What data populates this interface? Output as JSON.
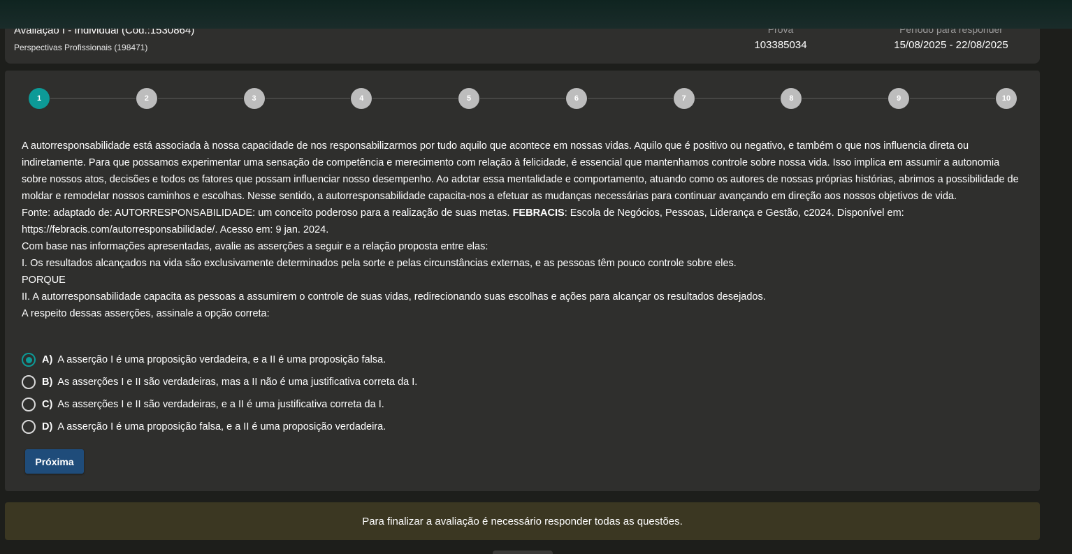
{
  "header": {
    "title": "Avaliação I - Individual (Cod.:1530864)",
    "course": "Perspectivas Profissionais (198471)",
    "prova_label": "Prova",
    "prova_value": "103385034",
    "periodo_label": "Período para responder",
    "periodo_value": "15/08/2025 - 22/08/2025"
  },
  "stepper": {
    "steps": [
      "1",
      "2",
      "3",
      "4",
      "5",
      "6",
      "7",
      "8",
      "9",
      "10"
    ],
    "active_step": 1,
    "colors": {
      "active": "#0d9a97",
      "inactive": "#bdbdbd"
    }
  },
  "question": {
    "text": "A autorresponsabilidade está associada à nossa capacidade de nos responsabilizarmos por tudo aquilo que acontece em nossas vidas. Aquilo que é positivo ou negativo, e também o que nos influencia direta ou indiretamente. Para que possamos experimentar uma sensação de competência e merecimento com relação à felicidade, é essencial que mantenhamos controle sobre nossa vida. Isso implica em assumir a autonomia sobre nossos atos, decisões e todos os fatores que possam influenciar nosso desempenho. Ao adotar essa mentalidade e comportamento, atuando como os autores de nossas próprias histórias, abrimos a possibilidade de moldar e remodelar nossos caminhos e escolhas. Nesse sentido, a autorresponsabilidade capacita-nos a efetuar as mudanças necessárias para continuar avançando em direção aos nossos objetivos de vida.",
    "source_prefix": "Fonte: adaptado de: AUTORRESPONSABILIDADE: um conceito poderoso para a realização de suas metas. ",
    "source_bold": "FEBRACIS",
    "source_suffix": ": Escola de Negócios, Pessoas, Liderança e Gestão, c2024. Disponível em: https://febracis.com/autorresponsabilidade/. Acesso em: 9 jan. 2024.",
    "instruction": "Com base nas informações apresentadas, avalie as asserções a seguir e a relação proposta entre elas:",
    "assertion_1": "I. Os resultados alcançados na vida são exclusivamente determinados pela sorte e pelas circunstâncias externas, e as pessoas têm pouco controle sobre eles.",
    "porque": "PORQUE",
    "assertion_2": "II. A autorresponsabilidade capacita as pessoas a assumirem o controle de suas vidas, redirecionando suas escolhas e ações para alcançar os resultados desejados.",
    "prompt": "A respeito dessas asserções, assinale a opção correta:"
  },
  "options": [
    {
      "letter": "A)",
      "text": "A asserção I é uma proposição verdadeira, e a II é uma proposição falsa.",
      "selected": true
    },
    {
      "letter": "B)",
      "text": "As asserções I e II são verdadeiras, mas a II não é uma justificativa correta da I.",
      "selected": false
    },
    {
      "letter": "C)",
      "text": "As asserções I e II são verdadeiras, e a II é uma justificativa correta da I.",
      "selected": false
    },
    {
      "letter": "D)",
      "text": "A asserção I é uma proposição falsa, e a II é uma proposição verdadeira.",
      "selected": false
    }
  ],
  "next_button": "Próxima",
  "notice": "Para finalizar a avaliação é necessário responder todas as questões."
}
